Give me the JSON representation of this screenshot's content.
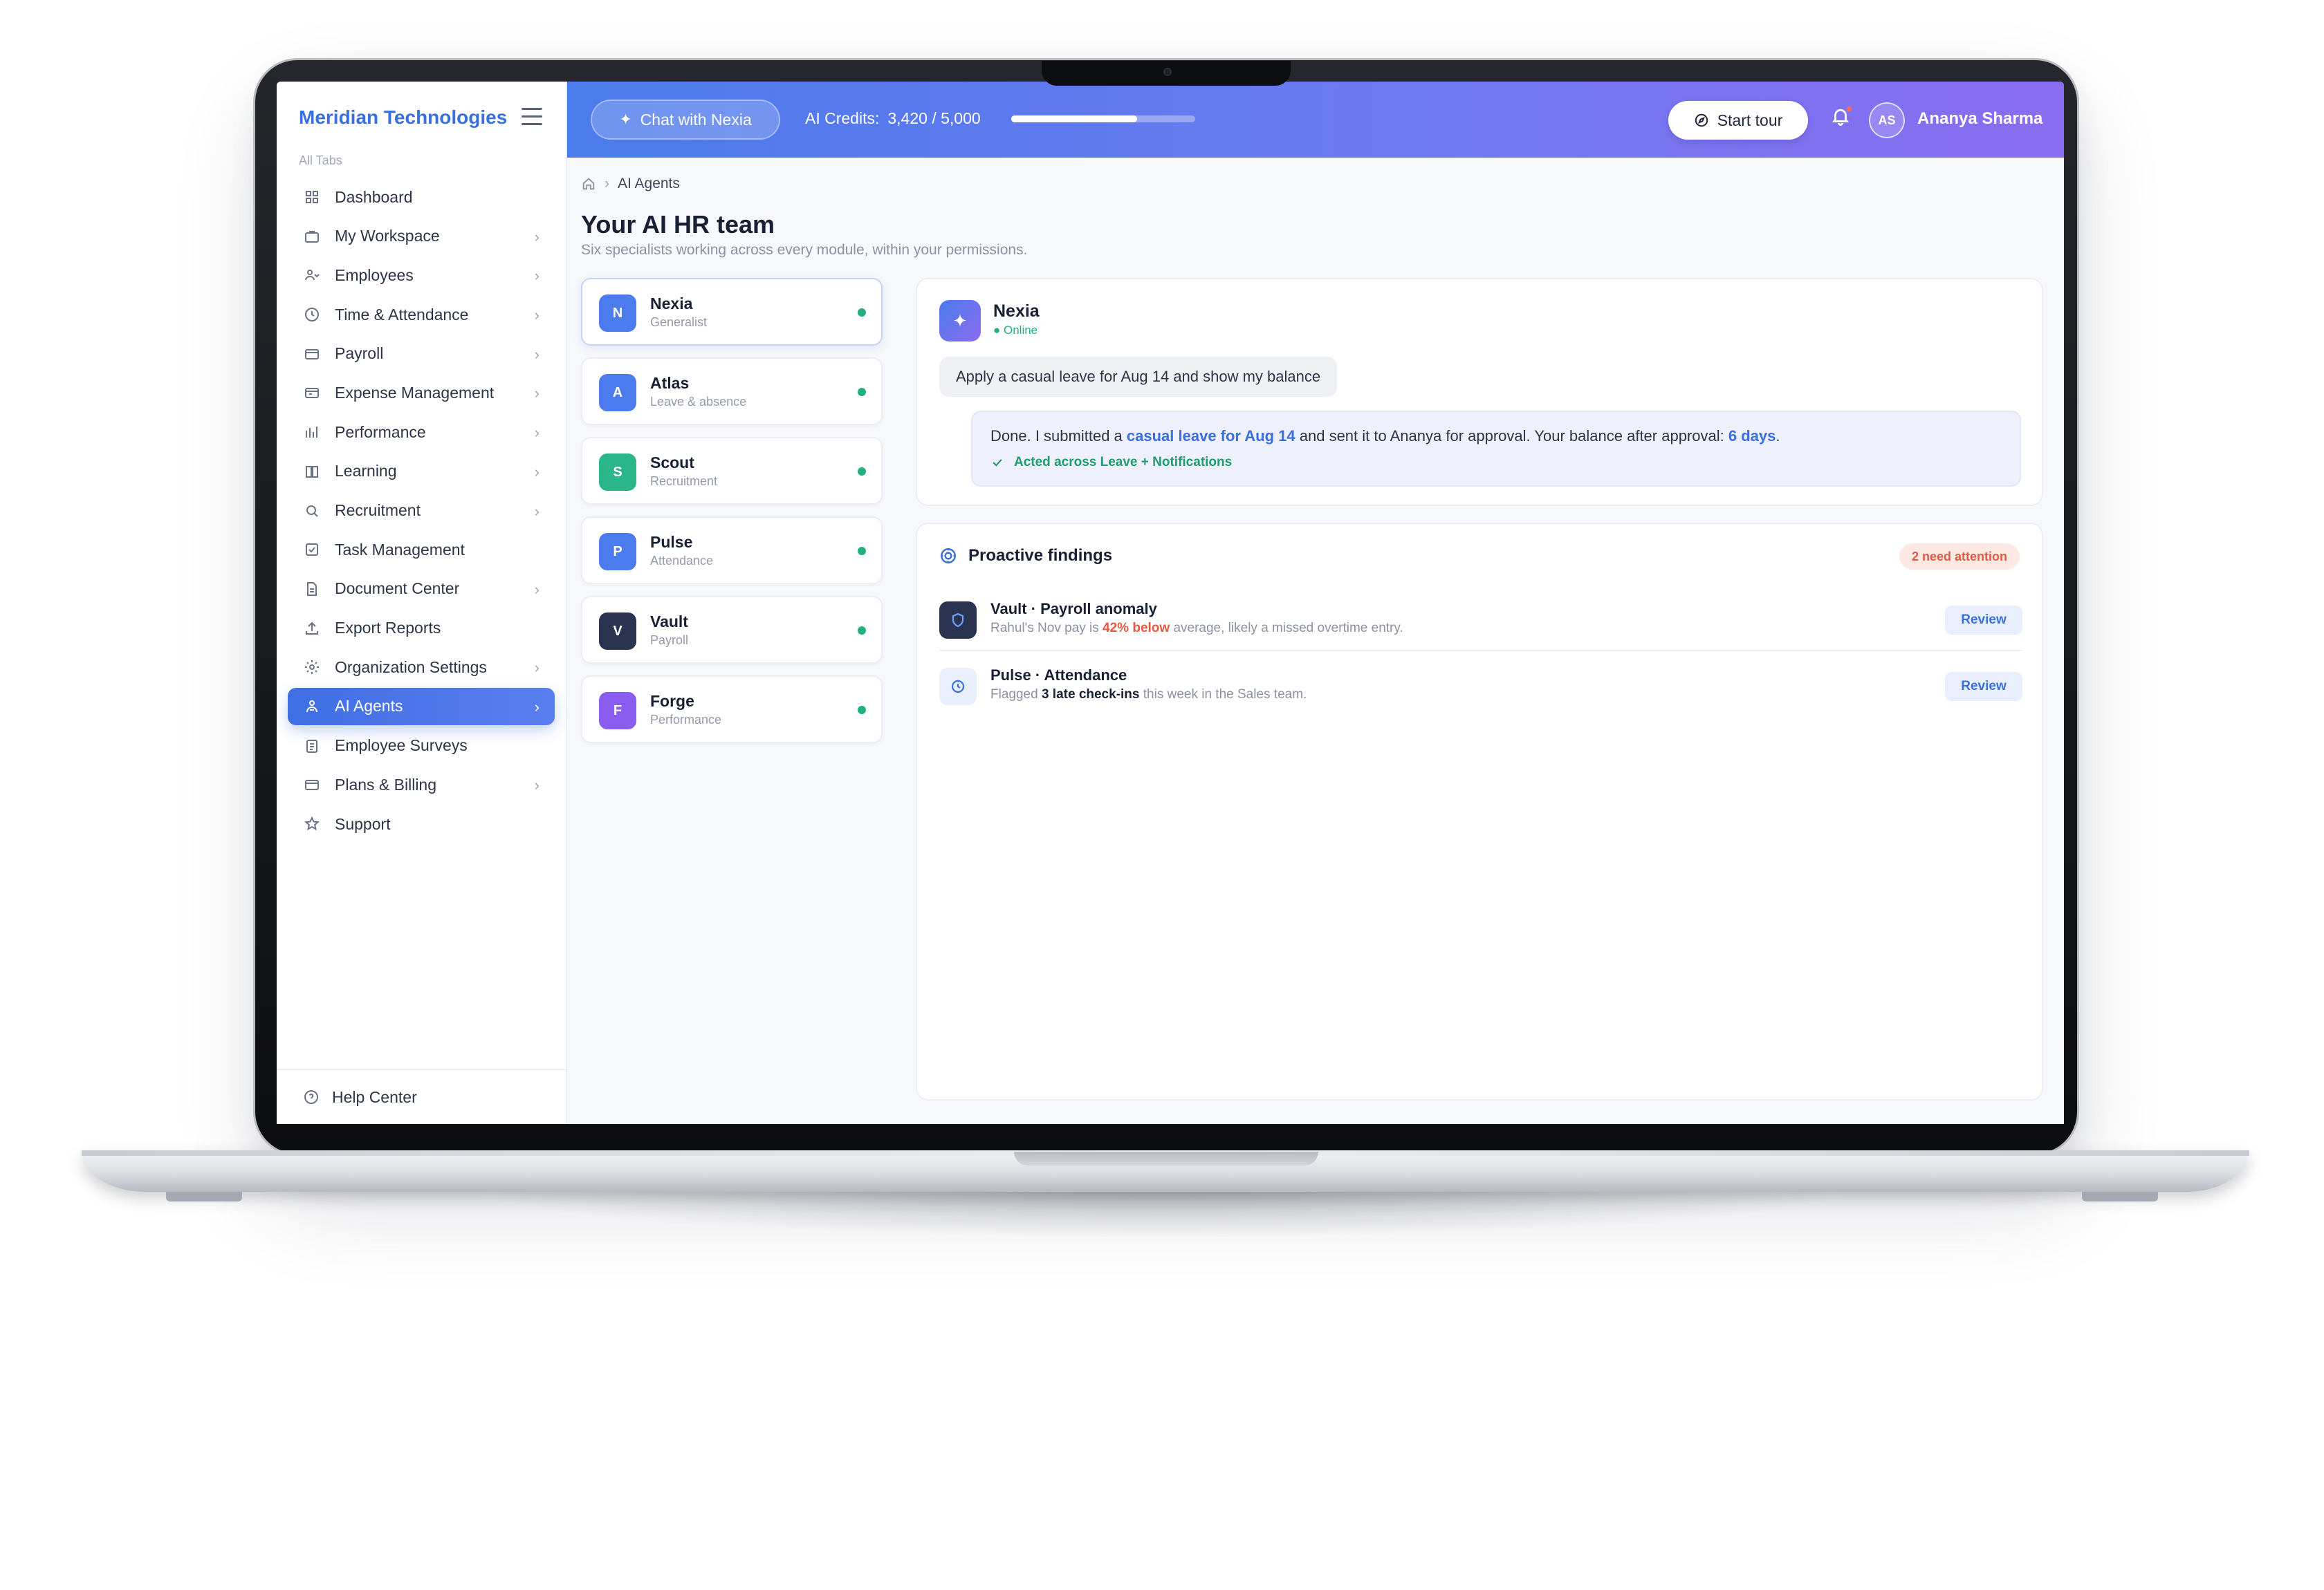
{
  "sidebar": {
    "brand": "Meridian Technologies",
    "section_label": "All Tabs",
    "items": [
      {
        "label": "Dashboard",
        "icon": "grid-icon",
        "has_chevron": false
      },
      {
        "label": "My Workspace",
        "icon": "briefcase-icon",
        "has_chevron": true
      },
      {
        "label": "Employees",
        "icon": "users-icon",
        "has_chevron": true
      },
      {
        "label": "Time & Attendance",
        "icon": "clock-icon",
        "has_chevron": true
      },
      {
        "label": "Payroll",
        "icon": "credit-card-icon",
        "has_chevron": true
      },
      {
        "label": "Expense Management",
        "icon": "wallet-icon",
        "has_chevron": true
      },
      {
        "label": "Performance",
        "icon": "bar-chart-icon",
        "has_chevron": true
      },
      {
        "label": "Learning",
        "icon": "book-icon",
        "has_chevron": true
      },
      {
        "label": "Recruitment",
        "icon": "search-icon",
        "has_chevron": true
      },
      {
        "label": "Task Management",
        "icon": "checkbox-icon",
        "has_chevron": false
      },
      {
        "label": "Document Center",
        "icon": "document-icon",
        "has_chevron": true
      },
      {
        "label": "Export Reports",
        "icon": "upload-icon",
        "has_chevron": false
      },
      {
        "label": "Organization Settings",
        "icon": "gear-icon",
        "has_chevron": true
      },
      {
        "label": "AI Agents",
        "icon": "robot-icon",
        "has_chevron": true,
        "active": true
      },
      {
        "label": "Employee Surveys",
        "icon": "clipboard-icon",
        "has_chevron": false
      },
      {
        "label": "Plans & Billing",
        "icon": "credit-card-icon",
        "has_chevron": true
      },
      {
        "label": "Support",
        "icon": "star-icon",
        "has_chevron": false
      }
    ],
    "footer": "Help Center"
  },
  "header": {
    "chat_button": "Chat with Nexia",
    "credits_label": "AI Credits:",
    "credits_value": "3,420 / 5,000",
    "credits_fraction": 0.684,
    "tour_button": "Start tour",
    "avatar_initials": "AS",
    "user_name": "Ananya Sharma"
  },
  "breadcrumb": {
    "current": "AI Agents"
  },
  "page": {
    "title": "Your AI HR team",
    "subtitle": "Six specialists working across every module, within your permissions."
  },
  "agents": [
    {
      "initial": "N",
      "name": "Nexia",
      "role": "Generalist",
      "color": "#4b7bec",
      "selected": true
    },
    {
      "initial": "A",
      "name": "Atlas",
      "role": "Leave & absence",
      "color": "#4b7bec"
    },
    {
      "initial": "S",
      "name": "Scout",
      "role": "Recruitment",
      "color": "#2bb68a"
    },
    {
      "initial": "P",
      "name": "Pulse",
      "role": "Attendance",
      "color": "#4b7bec"
    },
    {
      "initial": "V",
      "name": "Vault",
      "role": "Payroll",
      "color": "#2a3450"
    },
    {
      "initial": "F",
      "name": "Forge",
      "role": "Performance",
      "color": "#8a5cf0"
    }
  ],
  "chat": {
    "agent_name": "Nexia",
    "status": "● Online",
    "user_message": "Apply a casual leave for Aug 14 and show my balance",
    "reply_pre": "Done. I submitted a ",
    "reply_link": "casual leave for Aug 14",
    "reply_mid": " and sent it to Ananya for approval. Your balance after approval: ",
    "reply_balance": "6 days",
    "reply_end": ".",
    "reply_meta": "Acted across Leave + Notifications"
  },
  "findings": {
    "title": "Proactive findings",
    "badge": "2 need attention",
    "items": [
      {
        "title": "Vault · Payroll anomaly",
        "desc_pre": "Rahul's Nov pay is ",
        "desc_highlight": "42% below",
        "desc_post": " average, likely a missed overtime entry.",
        "action": "Review"
      },
      {
        "title": "Pulse · Attendance",
        "desc_pre": "Flagged ",
        "desc_highlight": "3 late check-ins",
        "desc_post": " this week in the Sales team.",
        "action": "Review"
      }
    ]
  }
}
